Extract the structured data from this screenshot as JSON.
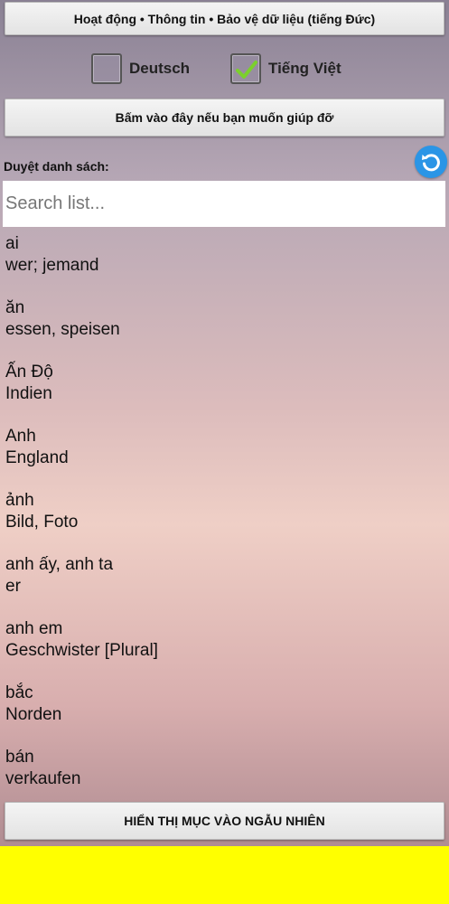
{
  "header": {
    "info_button": "Hoạt động • Thông tin • Bảo vệ dữ liệu (tiếng Đức)"
  },
  "languages": [
    {
      "label": "Deutsch",
      "checked": false
    },
    {
      "label": "Tiếng Việt",
      "checked": true
    }
  ],
  "help_button": "Bấm vào đây nếu bạn muốn giúp đỡ",
  "browse_label": "Duyệt danh sách:",
  "search": {
    "placeholder": "Search list...",
    "value": ""
  },
  "items": [
    {
      "vi": "ai",
      "de": "wer; jemand"
    },
    {
      "vi": "ăn",
      "de": "essen, speisen"
    },
    {
      "vi": "Ấn Độ",
      "de": "Indien"
    },
    {
      "vi": "Anh",
      "de": "England"
    },
    {
      "vi": "ảnh",
      "de": "Bild, Foto"
    },
    {
      "vi": "anh ấy, anh ta",
      "de": "er"
    },
    {
      "vi": "anh em",
      "de": "Geschwister [Plural]"
    },
    {
      "vi": "bắc",
      "de": "Norden"
    },
    {
      "vi": "bán",
      "de": "verkaufen"
    }
  ],
  "random_button": "HIỂN THỊ MỤC VÀO NGẪU NHIÊN",
  "colors": {
    "accent": "#2a95e6",
    "check": "#7bd02c",
    "ad_banner": "#ffff00"
  }
}
